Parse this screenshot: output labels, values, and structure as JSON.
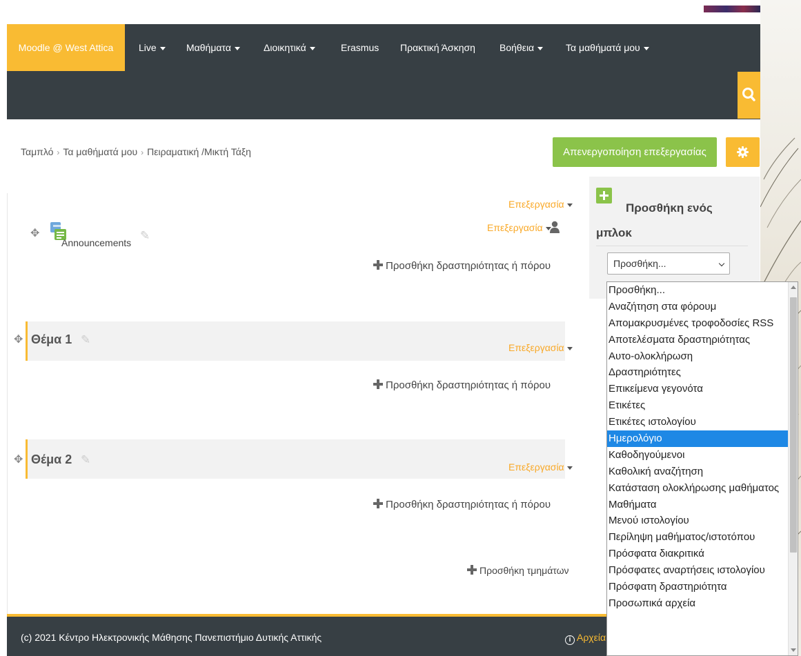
{
  "navbar": {
    "brand": "Moodle @ West Attica",
    "items": [
      {
        "label": "Live",
        "dropdown": true
      },
      {
        "label": "Μαθήματα",
        "dropdown": true
      },
      {
        "label": "Διοικητικά",
        "dropdown": true
      },
      {
        "label": "Erasmus",
        "dropdown": false
      },
      {
        "label": "Πρακτική Άσκηση",
        "dropdown": false
      },
      {
        "label": "Βοήθεια",
        "dropdown": true
      },
      {
        "label": "Τα μαθήματά μου",
        "dropdown": true
      }
    ]
  },
  "breadcrumb": [
    "Ταμπλό",
    "Τα μαθήματά μου",
    "Πειραματική /Μικτή Τάξη"
  ],
  "edit_off_button": "Απενεργοποίηση επεξεργασίας",
  "course": {
    "edit_label": "Επεξεργασία",
    "add_activity_label": "Προσθήκη δραστηριότητας ή πόρου",
    "announcements": "Announcements",
    "sections": [
      {
        "title": "Θέμα 1"
      },
      {
        "title": "Θέμα 2"
      }
    ],
    "add_sections_label": "Προσθήκη τμημάτων"
  },
  "block_panel": {
    "title": "Προσθήκη ενός μπλοκ",
    "select_value": "Προσθήκη..."
  },
  "dropdown_options": [
    "Προσθήκη...",
    "Αναζήτηση στα φόρουμ",
    "Απομακρυσμένες τροφοδοσίες RSS",
    "Αποτελέσματα δραστηριότητας",
    "Αυτο-ολοκλήρωση",
    "Δραστηριότητες",
    "Επικείμενα γεγονότα",
    "Ετικέτες",
    "Ετικέτες ιστολογίου",
    "Ημερολόγιο",
    "Καθοδηγούμενοι",
    "Καθολική αναζήτηση",
    "Κατάσταση ολοκλήρωσης μαθήματος",
    "Μαθήματα",
    "Μενού ιστολογίου",
    "Περίληψη μαθήματος/ιστοτόπου",
    "Πρόσφατα διακριτικά",
    "Πρόσφατες αναρτήσεις ιστολογίου",
    "Πρόσφατη δραστηριότητα",
    "Προσωπικά αρχεία"
  ],
  "dropdown_selected": "Ημερολόγιο",
  "footer": {
    "copyright": "(c) 2021 Κέντρο Ηλεκτρονικής Μάθησης Πανεπιστήμιο Δυτικής Αττικής",
    "help_link": "Αρχεία βοή"
  },
  "colors": {
    "accent": "#f9bb33",
    "navbar": "#373f44",
    "green": "#8bc34a",
    "selected": "#1e88e5"
  }
}
